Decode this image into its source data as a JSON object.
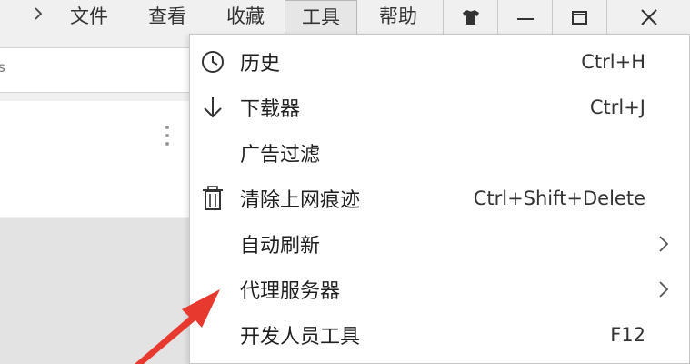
{
  "menubar": {
    "items": [
      {
        "label": "文件"
      },
      {
        "label": "查看"
      },
      {
        "label": "收藏"
      },
      {
        "label": "工具"
      },
      {
        "label": "帮助"
      }
    ],
    "active_index": 3
  },
  "window_buttons": {
    "skin_icon": "tshirt-icon",
    "minimize_icon": "minimize-icon",
    "maximize_icon": "restore-icon",
    "close_icon": "close-icon"
  },
  "address": {
    "fragment": "s"
  },
  "tools_menu": {
    "items": [
      {
        "icon": "clock-icon",
        "label": "历史",
        "shortcut": "Ctrl+H"
      },
      {
        "icon": "download-arrow-icon",
        "label": "下载器",
        "shortcut": "Ctrl+J"
      },
      {
        "icon": "",
        "label": "广告过滤",
        "shortcut": ""
      },
      {
        "icon": "trash-icon",
        "label": "清除上网痕迹",
        "shortcut": "Ctrl+Shift+Delete"
      },
      {
        "icon": "",
        "label": "自动刷新",
        "shortcut": "",
        "submenu": true
      },
      {
        "icon": "",
        "label": "代理服务器",
        "shortcut": "",
        "submenu": true
      },
      {
        "icon": "",
        "label": "开发人员工具",
        "shortcut": "F12"
      }
    ]
  },
  "colors": {
    "arrow": "#e8392e",
    "menu_bg": "#ffffff",
    "bar_bg": "#f0f0f0"
  }
}
